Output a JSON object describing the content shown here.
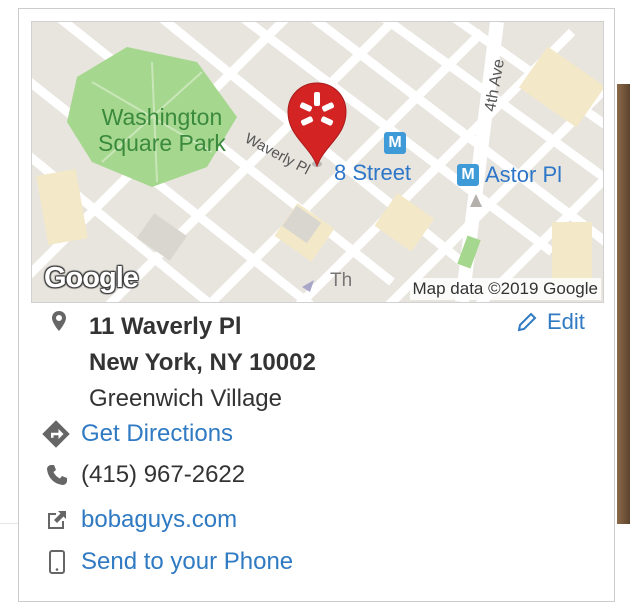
{
  "map": {
    "park_label": "Washington\nSquare Park",
    "street_waverly": "Waverly Pl",
    "street_4th_ave": "4th Ave",
    "street_partial_1": "St",
    "street_partial_2": "t",
    "street_partial_bottom": "Th",
    "metro_1": {
      "badge": "M",
      "label": "8 Street"
    },
    "metro_2": {
      "badge": "M",
      "label": "Astor Pl"
    },
    "google_logo": "Google",
    "attribution": "Map data ©2019 Google",
    "pin_color": "#d32323"
  },
  "address": {
    "line1": "11 Waverly Pl",
    "line2": "New York, NY 10002",
    "neighborhood": "Greenwich Village"
  },
  "edit_label": "Edit",
  "actions": {
    "directions": "Get Directions",
    "phone": "(415) 967-2622",
    "website": "bobaguys.com",
    "send_to_phone": "Send to your Phone"
  },
  "colors": {
    "link": "#2f7ac2",
    "text": "#333333",
    "icon": "#666666",
    "park": "#a6d78f"
  }
}
